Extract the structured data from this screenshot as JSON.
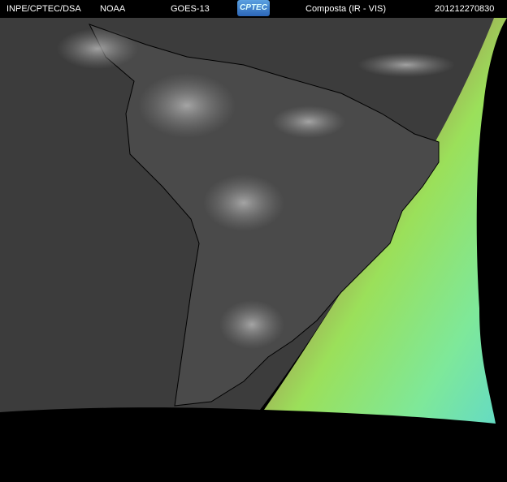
{
  "header": {
    "institution": "INPE/CPTEC/DSA",
    "agency": "NOAA",
    "satellite": "GOES-13",
    "logo_text": "CPTEC",
    "product": "Composta (IR - VIS)",
    "timestamp": "201212270830"
  }
}
